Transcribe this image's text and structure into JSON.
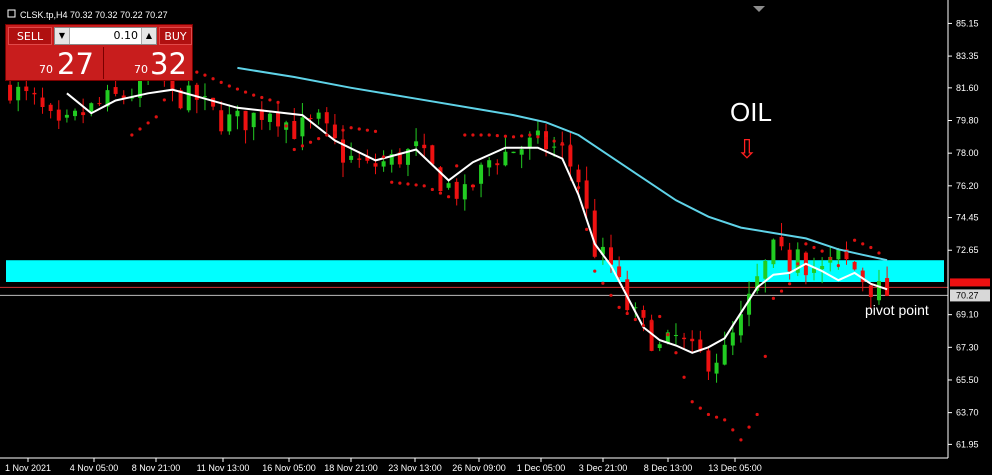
{
  "header": {
    "symbol_info": "CLSK.tp,H4  70.32 70.32 70.22 70.27"
  },
  "trade_panel": {
    "sell_label": "SELL",
    "buy_label": "BUY",
    "lot_value": "0.10",
    "bid_prefix": "70",
    "bid_big": "27",
    "ask_prefix": "70",
    "ask_big": "32"
  },
  "colors": {
    "background": "#000000",
    "bull": "#22cc22",
    "bear": "#ee1111",
    "ma_slow": "#5fd3e8",
    "ma_fast": "#ffffff",
    "sar": "#dd1111",
    "zone": "#00ffff",
    "grid_text": "#ffffff"
  },
  "chart_data": {
    "type": "candlestick",
    "title": "CLSK.tp,H4",
    "y_ticks": [
      "85.15",
      "83.35",
      "81.60",
      "79.80",
      "78.00",
      "76.20",
      "74.45",
      "72.65",
      "70.27",
      "69.10",
      "67.30",
      "65.50",
      "63.70",
      "61.95"
    ],
    "x_ticks": [
      "1 Nov 2021",
      "4 Nov 05:00",
      "8 Nov 21:00",
      "11 Nov 13:00",
      "16 Nov 05:00",
      "18 Nov 21:00",
      "23 Nov 13:00",
      "26 Nov 09:00",
      "1 Dec 05:00",
      "3 Dec 21:00",
      "8 Dec 13:00",
      "13 Dec 05:00"
    ],
    "ylim": [
      61.2,
      86.0
    ],
    "current_price": 70.27,
    "price_label_box": "70.27",
    "resistance_zone": {
      "low": 70.9,
      "high": 72.1
    },
    "pivot_line": 70.6,
    "annotations": {
      "title": "OIL",
      "arrow": "⇩",
      "pivot_label": "pivot point"
    },
    "close_path": [
      [
        0,
        81.6
      ],
      [
        3,
        80.8
      ],
      [
        6,
        79.2
      ],
      [
        9,
        80.2
      ],
      [
        12,
        80.9
      ],
      [
        15,
        81.3
      ],
      [
        18,
        82.6
      ],
      [
        20,
        81.1
      ],
      [
        23,
        81.0
      ],
      [
        26,
        79.8
      ],
      [
        29,
        79.8
      ],
      [
        32,
        80.5
      ],
      [
        35,
        79.3
      ],
      [
        38,
        79.7
      ],
      [
        41,
        77.9
      ],
      [
        44,
        77.2
      ],
      [
        47,
        77.6
      ],
      [
        50,
        78.2
      ],
      [
        53,
        76.5
      ],
      [
        56,
        75.6
      ],
      [
        59,
        77.6
      ],
      [
        62,
        78.2
      ],
      [
        65,
        78.6
      ],
      [
        68,
        78.1
      ],
      [
        70,
        76.6
      ],
      [
        72,
        72.7
      ],
      [
        74,
        71.8
      ],
      [
        76,
        69.5
      ],
      [
        78,
        68.4
      ],
      [
        80,
        67.2
      ],
      [
        82,
        67.8
      ],
      [
        84,
        67.0
      ],
      [
        86,
        66.6
      ],
      [
        88,
        67.0
      ],
      [
        90,
        68.7
      ],
      [
        92,
        70.9
      ],
      [
        94,
        72.6
      ],
      [
        96,
        71.9
      ],
      [
        97,
        73.2
      ],
      [
        98,
        71.9
      ],
      [
        100,
        71.5
      ],
      [
        102,
        72.3
      ],
      [
        104,
        71.6
      ],
      [
        106,
        70.6
      ],
      [
        108,
        70.27
      ]
    ],
    "ma_slow": [
      [
        28,
        82.7
      ],
      [
        35,
        82.2
      ],
      [
        42,
        81.6
      ],
      [
        50,
        81.0
      ],
      [
        58,
        80.4
      ],
      [
        62,
        80.1
      ],
      [
        66,
        79.7
      ],
      [
        70,
        79.0
      ],
      [
        74,
        77.8
      ],
      [
        78,
        76.6
      ],
      [
        82,
        75.4
      ],
      [
        86,
        74.5
      ],
      [
        90,
        73.9
      ],
      [
        94,
        73.6
      ],
      [
        98,
        73.3
      ],
      [
        102,
        72.7
      ],
      [
        105,
        72.4
      ],
      [
        108,
        72.1
      ]
    ],
    "ma_fast": [
      [
        7,
        81.3
      ],
      [
        10,
        80.2
      ],
      [
        13,
        80.9
      ],
      [
        17,
        81.3
      ],
      [
        20,
        81.5
      ],
      [
        24,
        81.0
      ],
      [
        28,
        80.5
      ],
      [
        32,
        80.3
      ],
      [
        36,
        80.1
      ],
      [
        40,
        78.7
      ],
      [
        45,
        77.6
      ],
      [
        50,
        78.2
      ],
      [
        54,
        76.5
      ],
      [
        57,
        77.5
      ],
      [
        61,
        78.3
      ],
      [
        65,
        78.3
      ],
      [
        68,
        77.7
      ],
      [
        70,
        75.7
      ],
      [
        72,
        73.0
      ],
      [
        74,
        71.8
      ],
      [
        76,
        70.1
      ],
      [
        78,
        68.4
      ],
      [
        80,
        67.7
      ],
      [
        82,
        67.4
      ],
      [
        84,
        67.0
      ],
      [
        86,
        67.3
      ],
      [
        88,
        67.8
      ],
      [
        90,
        69.2
      ],
      [
        92,
        70.6
      ],
      [
        94,
        71.3
      ],
      [
        96,
        71.4
      ],
      [
        98,
        71.9
      ],
      [
        100,
        71.5
      ],
      [
        102,
        71.0
      ],
      [
        104,
        71.4
      ],
      [
        106,
        70.8
      ],
      [
        108,
        70.5
      ]
    ],
    "sar": [
      [
        15,
        79.0
      ],
      [
        18,
        80.0
      ],
      [
        21,
        82.8
      ],
      [
        24,
        82.3
      ],
      [
        27,
        81.7
      ],
      [
        30,
        81.2
      ],
      [
        33,
        80.8
      ],
      [
        35,
        78.2
      ],
      [
        39,
        79.0
      ],
      [
        42,
        79.4
      ],
      [
        45,
        79.2
      ],
      [
        47,
        76.4
      ],
      [
        51,
        76.2
      ],
      [
        54,
        75.6
      ],
      [
        56,
        79.0
      ],
      [
        59,
        79.0
      ],
      [
        62,
        78.9
      ],
      [
        64,
        79.0
      ],
      [
        66,
        78.8
      ],
      [
        69,
        78.4
      ],
      [
        72,
        71.5
      ],
      [
        75,
        69.5
      ],
      [
        78,
        68.5
      ],
      [
        80,
        69.0
      ],
      [
        82,
        67.0
      ],
      [
        84,
        64.3
      ],
      [
        86,
        63.6
      ],
      [
        88,
        63.3
      ],
      [
        90,
        62.2
      ],
      [
        92,
        63.6
      ],
      [
        94,
        70.0
      ],
      [
        96,
        70.8
      ],
      [
        98,
        73.0
      ],
      [
        100,
        72.6
      ],
      [
        102,
        71.8
      ],
      [
        104,
        73.2
      ],
      [
        106,
        72.8
      ],
      [
        108,
        72.2
      ]
    ]
  }
}
